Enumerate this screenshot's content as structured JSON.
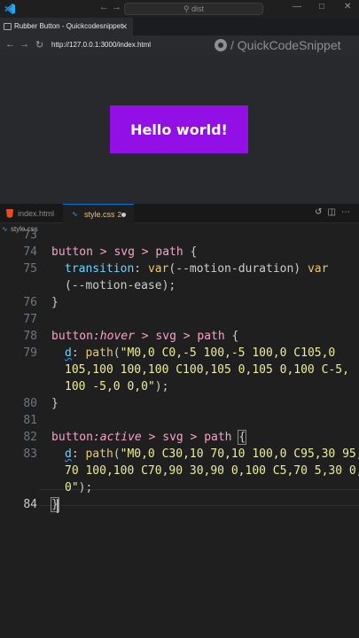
{
  "titlebar": {
    "search_placeholder": "dist",
    "back_icon": "arrow-left-icon",
    "forward_icon": "arrow-right-icon"
  },
  "browser": {
    "tab_title": "Rubber Button - Quickcodesnippet",
    "url": "http://127.0.0.1:3000/index.html",
    "watermark": "/ QuickCodeSnippet",
    "button_label": "Hello world!",
    "button_color": "#9210e6"
  },
  "editor": {
    "tabs": [
      {
        "label": "index.html",
        "icon": "html5-icon"
      },
      {
        "label": "style.css",
        "icon": "css-icon",
        "problems": "2",
        "modified": true
      }
    ],
    "breadcrumb": "style.css"
  },
  "code": {
    "line_numbers": [
      "73",
      "74",
      "75",
      "",
      "76",
      "77",
      "78",
      "79",
      "",
      "",
      "80",
      "81",
      "82",
      "83",
      "",
      "",
      "84"
    ],
    "l74": {
      "sel": "button > svg > path",
      "brace": " {"
    },
    "l75a": {
      "prop": "transition",
      "colon": ": ",
      "fn": "var",
      "arg": "(--motion-duration) ",
      "fn2": "var"
    },
    "l75b": {
      "arg": "(--motion-ease);"
    },
    "l76": {
      "brace": "}"
    },
    "l78": {
      "sel1": "button",
      "pseudo": ":hover",
      "sel2": " > svg > path",
      "brace": " {"
    },
    "l79a": {
      "prop": "d",
      "colon": ": ",
      "fn": "path",
      "open": "(",
      "str": "\"M0,0 C0,-5 100,-5 100,0 C105,0"
    },
    "l79b": {
      "str": "105,100 100,100 C100,105 0,105 0,100 C-5,"
    },
    "l79c": {
      "str": "100 -5,0 0,0\"",
      "close": ");"
    },
    "l80": {
      "brace": "}"
    },
    "l82": {
      "sel1": "button",
      "pseudo": ":active",
      "sel2": " > svg > path",
      "brace": "{"
    },
    "l83a": {
      "prop": "d",
      "colon": ": ",
      "fn": "path",
      "open": "(",
      "str": "\"M0,0 C30,10 70,10 100,0 C95,30 95,"
    },
    "l83b": {
      "str": "70 100,100 C70,90 30,90 0,100 C5,70 5,30 0,"
    },
    "l83c": {
      "str": "0\"",
      "close": ");"
    },
    "l84": {
      "brace": "}"
    }
  }
}
